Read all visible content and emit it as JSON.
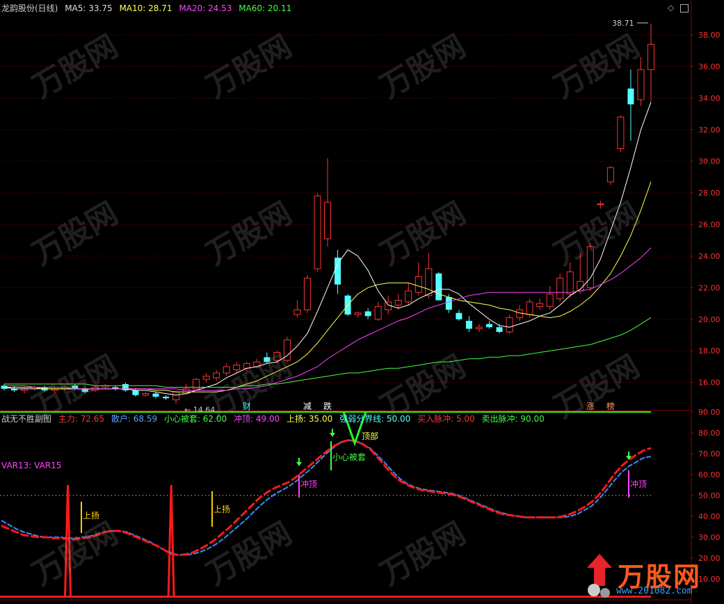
{
  "header": {
    "stock": "龙韵股份(日线)",
    "ma5": "MA5: 33.75",
    "ma10": "MA10: 28.71",
    "ma20": "MA20: 24.53",
    "ma60": "MA60: 20.11"
  },
  "sub_header": {
    "title": "战无不胜副图",
    "zhuli": "主力: 72.65",
    "sanhu": "散户: 68.59",
    "xiaoxin": "小心被套: 62.00",
    "chongding": "冲顶: 49.00",
    "shangyang": "上扬: 35.00",
    "qiangruo": "强弱分界线: 50.00",
    "mairu": "买入脉冲: 5.00",
    "maichu": "卖出脉冲: 90.00"
  },
  "var_label": "VAR13: VAR15",
  "watermark": {
    "text": "万股网",
    "url": "www.201082.com"
  },
  "logo": {
    "text": "万股网",
    "url": "www.201082.com"
  },
  "colors": {
    "background": "#000000",
    "axis": "#8b0000",
    "up": "#ff3333",
    "down": "#54ffff",
    "ma5": "#ffffff",
    "ma10": "#ffff55",
    "ma20": "#ff44ff",
    "ma60": "#44ff44",
    "zhuli": "#ff1a1a",
    "sanhu": "#3a8cff",
    "threshold": "#22ff22"
  },
  "chart_data": [
    {
      "type": "candlestick",
      "title": "",
      "ylim": [
        14.4,
        39.5
      ],
      "yticks": [
        "16.00",
        "18.00",
        "20.00",
        "22.00",
        "24.00",
        "26.00",
        "28.00",
        "30.00",
        "32.00",
        "34.00",
        "36.00",
        "38.00"
      ],
      "annotations": {
        "high": "38.71",
        "low": "14.64"
      },
      "event_markers": [
        "财",
        "减",
        "跌",
        "涨",
        "榜"
      ],
      "candles": [
        {
          "o": 15.8,
          "h": 15.9,
          "l": 15.5,
          "c": 15.6
        },
        {
          "o": 15.6,
          "h": 15.8,
          "l": 15.4,
          "c": 15.5
        },
        {
          "o": 15.5,
          "h": 15.7,
          "l": 15.3,
          "c": 15.6
        },
        {
          "o": 15.6,
          "h": 15.8,
          "l": 15.5,
          "c": 15.7
        },
        {
          "o": 15.7,
          "h": 15.8,
          "l": 15.4,
          "c": 15.5
        },
        {
          "o": 15.5,
          "h": 15.7,
          "l": 15.3,
          "c": 15.6
        },
        {
          "o": 15.6,
          "h": 15.8,
          "l": 15.5,
          "c": 15.7
        },
        {
          "o": 15.8,
          "h": 15.9,
          "l": 15.5,
          "c": 15.6
        },
        {
          "o": 15.6,
          "h": 15.7,
          "l": 15.3,
          "c": 15.4
        },
        {
          "o": 15.5,
          "h": 15.8,
          "l": 15.4,
          "c": 15.7
        },
        {
          "o": 15.7,
          "h": 15.9,
          "l": 15.6,
          "c": 15.8
        },
        {
          "o": 15.7,
          "h": 15.8,
          "l": 15.5,
          "c": 15.6
        },
        {
          "o": 15.9,
          "h": 16.0,
          "l": 15.4,
          "c": 15.5
        },
        {
          "o": 15.5,
          "h": 15.6,
          "l": 15.1,
          "c": 15.2
        },
        {
          "o": 15.2,
          "h": 15.4,
          "l": 15.1,
          "c": 15.3
        },
        {
          "o": 15.3,
          "h": 15.4,
          "l": 15.0,
          "c": 15.1
        },
        {
          "o": 15.1,
          "h": 15.2,
          "l": 14.9,
          "c": 15.0
        },
        {
          "o": 14.9,
          "h": 15.5,
          "l": 14.64,
          "c": 15.4
        },
        {
          "o": 15.3,
          "h": 15.9,
          "l": 15.2,
          "c": 15.6
        },
        {
          "o": 15.6,
          "h": 16.3,
          "l": 15.5,
          "c": 16.2
        },
        {
          "o": 16.2,
          "h": 16.6,
          "l": 16.0,
          "c": 16.4
        },
        {
          "o": 16.3,
          "h": 16.8,
          "l": 16.1,
          "c": 16.6
        },
        {
          "o": 16.6,
          "h": 17.2,
          "l": 16.4,
          "c": 17.0
        },
        {
          "o": 16.8,
          "h": 17.3,
          "l": 16.6,
          "c": 17.1
        },
        {
          "o": 16.9,
          "h": 17.3,
          "l": 16.7,
          "c": 17.2
        },
        {
          "o": 17.0,
          "h": 17.5,
          "l": 16.9,
          "c": 17.3
        },
        {
          "o": 17.6,
          "h": 17.9,
          "l": 17.2,
          "c": 17.3
        },
        {
          "o": 17.4,
          "h": 18.0,
          "l": 17.2,
          "c": 17.9
        },
        {
          "o": 17.4,
          "h": 18.9,
          "l": 17.3,
          "c": 18.7
        },
        {
          "o": 20.3,
          "h": 21.2,
          "l": 20.1,
          "c": 20.6
        },
        {
          "o": 20.6,
          "h": 22.8,
          "l": 20.4,
          "c": 22.6
        },
        {
          "o": 23.2,
          "h": 28.0,
          "l": 23.0,
          "c": 27.8
        },
        {
          "o": 25.1,
          "h": 30.2,
          "l": 24.6,
          "c": 27.4
        },
        {
          "o": 23.9,
          "h": 24.4,
          "l": 21.6,
          "c": 22.2
        },
        {
          "o": 21.5,
          "h": 21.6,
          "l": 20.2,
          "c": 20.3
        },
        {
          "o": 20.3,
          "h": 20.5,
          "l": 20.1,
          "c": 20.4
        },
        {
          "o": 20.5,
          "h": 20.7,
          "l": 20.0,
          "c": 20.2
        },
        {
          "o": 20.0,
          "h": 21.1,
          "l": 19.9,
          "c": 20.8
        },
        {
          "o": 20.6,
          "h": 21.5,
          "l": 20.3,
          "c": 21.1
        },
        {
          "o": 20.9,
          "h": 21.6,
          "l": 20.6,
          "c": 21.2
        },
        {
          "o": 21.1,
          "h": 22.3,
          "l": 20.9,
          "c": 21.8
        },
        {
          "o": 21.7,
          "h": 23.6,
          "l": 21.5,
          "c": 22.7
        },
        {
          "o": 21.5,
          "h": 24.2,
          "l": 21.3,
          "c": 23.2
        },
        {
          "o": 22.9,
          "h": 23.0,
          "l": 21.3,
          "c": 21.2
        },
        {
          "o": 21.4,
          "h": 21.6,
          "l": 20.4,
          "c": 20.6
        },
        {
          "o": 20.4,
          "h": 20.6,
          "l": 19.9,
          "c": 20.0
        },
        {
          "o": 19.9,
          "h": 20.2,
          "l": 19.2,
          "c": 19.4
        },
        {
          "o": 19.4,
          "h": 19.7,
          "l": 19.2,
          "c": 19.5
        },
        {
          "o": 19.7,
          "h": 19.9,
          "l": 19.4,
          "c": 19.5
        },
        {
          "o": 19.5,
          "h": 19.7,
          "l": 19.1,
          "c": 19.2
        },
        {
          "o": 19.2,
          "h": 20.3,
          "l": 19.1,
          "c": 20.1
        },
        {
          "o": 20.1,
          "h": 20.9,
          "l": 19.9,
          "c": 20.6
        },
        {
          "o": 20.3,
          "h": 21.3,
          "l": 20.1,
          "c": 21.1
        },
        {
          "o": 20.8,
          "h": 21.3,
          "l": 20.6,
          "c": 21.0
        },
        {
          "o": 20.8,
          "h": 22.1,
          "l": 20.6,
          "c": 21.6
        },
        {
          "o": 21.3,
          "h": 22.9,
          "l": 21.1,
          "c": 22.6
        },
        {
          "o": 21.6,
          "h": 23.6,
          "l": 21.4,
          "c": 23.0
        },
        {
          "o": 21.8,
          "h": 24.2,
          "l": 21.6,
          "c": 22.4
        },
        {
          "o": 22.0,
          "h": 24.8,
          "l": 21.8,
          "c": 24.6
        },
        {
          "o": 27.3,
          "h": 27.5,
          "l": 27.0,
          "c": 27.3
        },
        {
          "o": 28.7,
          "h": 29.7,
          "l": 28.5,
          "c": 29.6
        },
        {
          "o": 30.8,
          "h": 32.9,
          "l": 30.6,
          "c": 32.8
        },
        {
          "o": 34.6,
          "h": 35.8,
          "l": 31.3,
          "c": 33.6
        },
        {
          "o": 33.9,
          "h": 36.6,
          "l": 33.5,
          "c": 35.8
        },
        {
          "o": 35.8,
          "h": 38.71,
          "l": 33.8,
          "c": 37.4
        }
      ],
      "series": [
        {
          "name": "MA5",
          "values": [
            15.7,
            15.6,
            15.6,
            15.6,
            15.6,
            15.6,
            15.6,
            15.6,
            15.6,
            15.6,
            15.6,
            15.6,
            15.6,
            15.5,
            15.5,
            15.4,
            15.3,
            15.2,
            15.3,
            15.5,
            15.7,
            15.9,
            16.3,
            16.6,
            16.9,
            17.0,
            17.2,
            17.3,
            17.7,
            18.3,
            19.1,
            20.5,
            22.0,
            23.5,
            24.4,
            24.0,
            23.1,
            21.8,
            20.9,
            20.7,
            20.9,
            21.3,
            21.6,
            21.9,
            21.9,
            21.6,
            21.0,
            20.5,
            20.0,
            19.6,
            19.5,
            19.7,
            19.9,
            20.2,
            20.4,
            20.9,
            21.5,
            21.9,
            22.6,
            23.8,
            25.6,
            27.4,
            29.6,
            32.0,
            33.75
          ]
        },
        {
          "name": "MA10",
          "values": [
            15.7,
            15.7,
            15.7,
            15.7,
            15.6,
            15.6,
            15.6,
            15.6,
            15.6,
            15.6,
            15.6,
            15.6,
            15.6,
            15.6,
            15.6,
            15.5,
            15.5,
            15.4,
            15.4,
            15.4,
            15.4,
            15.4,
            15.5,
            15.7,
            15.9,
            16.1,
            16.4,
            16.7,
            17.0,
            17.3,
            17.8,
            18.5,
            19.3,
            20.1,
            20.9,
            21.6,
            22.0,
            22.2,
            22.3,
            22.3,
            22.3,
            22.1,
            21.9,
            21.6,
            21.4,
            21.2,
            21.1,
            21.0,
            20.9,
            20.7,
            20.6,
            20.4,
            20.3,
            20.2,
            20.1,
            20.2,
            20.5,
            20.9,
            21.4,
            22.1,
            22.9,
            24.0,
            25.3,
            26.9,
            28.71
          ]
        },
        {
          "name": "MA20",
          "values": [
            15.8,
            15.8,
            15.8,
            15.7,
            15.7,
            15.7,
            15.7,
            15.6,
            15.6,
            15.6,
            15.6,
            15.6,
            15.6,
            15.6,
            15.6,
            15.6,
            15.6,
            15.6,
            15.5,
            15.5,
            15.5,
            15.5,
            15.5,
            15.6,
            15.6,
            15.7,
            15.8,
            16.0,
            16.2,
            16.4,
            16.7,
            17.0,
            17.5,
            17.9,
            18.3,
            18.7,
            19.0,
            19.3,
            19.6,
            19.9,
            20.1,
            20.4,
            20.7,
            20.9,
            21.1,
            21.3,
            21.5,
            21.6,
            21.7,
            21.7,
            21.7,
            21.7,
            21.7,
            21.7,
            21.7,
            21.7,
            21.7,
            21.8,
            21.9,
            22.2,
            22.5,
            22.9,
            23.4,
            23.9,
            24.53
          ]
        },
        {
          "name": "MA60",
          "values": [
            15.9,
            15.9,
            15.9,
            15.9,
            15.9,
            15.9,
            15.9,
            15.9,
            15.9,
            15.8,
            15.8,
            15.8,
            15.8,
            15.8,
            15.8,
            15.8,
            15.7,
            15.7,
            15.7,
            15.7,
            15.7,
            15.7,
            15.7,
            15.7,
            15.8,
            15.8,
            15.9,
            15.9,
            16.0,
            16.1,
            16.2,
            16.3,
            16.4,
            16.5,
            16.6,
            16.6,
            16.7,
            16.8,
            16.9,
            16.9,
            17.0,
            17.1,
            17.2,
            17.3,
            17.3,
            17.4,
            17.5,
            17.5,
            17.6,
            17.6,
            17.7,
            17.7,
            17.8,
            17.9,
            18.0,
            18.1,
            18.2,
            18.3,
            18.4,
            18.6,
            18.8,
            19.0,
            19.3,
            19.7,
            20.11
          ]
        }
      ]
    },
    {
      "type": "line",
      "title": "",
      "ylim": [
        0,
        90
      ],
      "yticks": [
        "10.00",
        "20.00",
        "30.00",
        "40.00",
        "50.00",
        "60.00",
        "70.00",
        "80.00",
        "90.00"
      ],
      "annotation_labels": {
        "shangyang": "上扬",
        "chongding": "冲顶",
        "xiaoxin": "小心被套",
        "dingbu": "顶部"
      },
      "series": [
        {
          "name": "主力",
          "values": [
            35.5,
            34,
            32.5,
            31,
            30.5,
            30,
            30,
            29.5,
            29.5,
            29,
            29,
            29.5,
            30,
            31,
            32.5,
            33,
            33,
            32,
            30.5,
            29,
            27.5,
            26,
            24,
            22,
            21.5,
            21.8,
            22.8,
            24.5,
            26.5,
            29,
            32,
            35,
            38.5,
            42,
            45.5,
            49,
            51.5,
            53.5,
            55,
            56.5,
            59,
            62,
            65,
            68,
            71,
            73.5,
            75.5,
            76.5,
            76,
            74.5,
            72,
            68,
            64,
            60,
            57,
            55,
            53.5,
            52.5,
            52,
            51.5,
            51,
            50.5,
            49.5,
            48,
            46.5,
            45,
            43.5,
            42,
            41,
            40.5,
            40,
            39.5,
            39.5,
            39.5,
            39.5,
            39.5,
            40,
            41,
            42.5,
            44.5,
            47,
            50.5,
            55,
            60,
            64,
            67,
            69.5,
            71.5,
            72.65
          ]
        },
        {
          "name": "散户",
          "values": [
            38,
            36,
            34,
            32.5,
            31.5,
            30.5,
            30,
            30,
            30,
            29.5,
            29.5,
            30,
            30.5,
            31.5,
            32.5,
            33,
            33,
            32.5,
            31,
            29.5,
            28,
            26,
            24,
            22.5,
            21.5,
            21.5,
            22,
            23,
            24.5,
            26.5,
            29,
            32,
            35,
            38,
            41.5,
            45,
            48,
            50.5,
            52.5,
            54.5,
            57,
            60,
            63,
            66.5,
            70,
            73,
            75.5,
            76.5,
            76,
            74.5,
            72.5,
            69,
            65.5,
            61.5,
            58,
            55.5,
            54,
            53,
            52.5,
            52,
            51.5,
            51,
            50,
            48.5,
            47,
            45.5,
            44,
            42.5,
            41.5,
            40.5,
            40,
            39.5,
            39.5,
            39.5,
            39.5,
            39.5,
            39.5,
            40,
            41,
            43,
            45,
            48.5,
            52.5,
            57,
            61,
            64,
            66,
            68,
            68.59
          ]
        }
      ]
    }
  ]
}
